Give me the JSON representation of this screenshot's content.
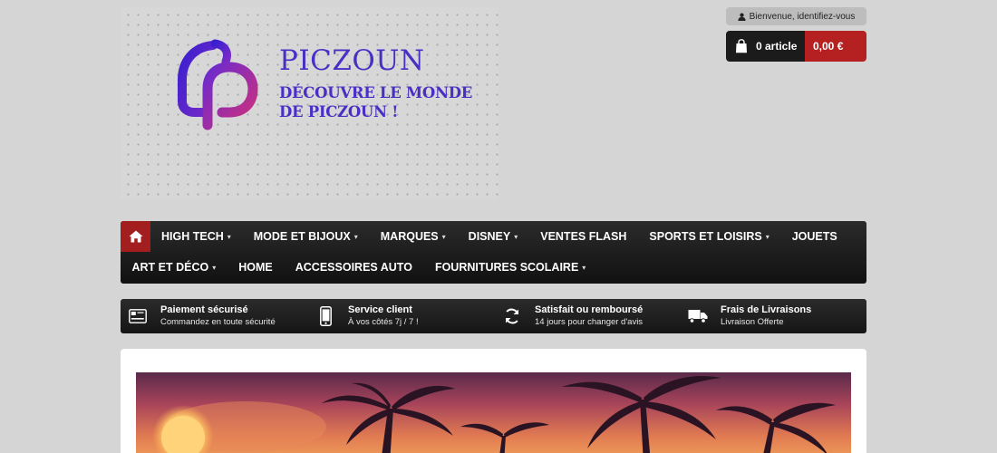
{
  "brand": {
    "name": "PICZOUN",
    "tagline_line1": "DÉCOUVRE LE MONDE",
    "tagline_line2": "DE PICZOUN !",
    "colors": {
      "purple": "#4a2fc4",
      "magenta": "#c2307a"
    }
  },
  "account": {
    "label": "Bienvenue, identifiez-vous",
    "icon": "user-icon"
  },
  "cart": {
    "count_label": "0 article",
    "total": "0,00 €",
    "icon": "shopping-bag-icon",
    "accent": "#b52121"
  },
  "nav": {
    "home_icon": "home-icon",
    "row1": [
      {
        "label": "HIGH TECH",
        "has_dropdown": true
      },
      {
        "label": "MODE ET BIJOUX",
        "has_dropdown": true
      },
      {
        "label": "MARQUES",
        "has_dropdown": true
      },
      {
        "label": "DISNEY",
        "has_dropdown": true
      },
      {
        "label": "VENTES FLASH",
        "has_dropdown": false
      },
      {
        "label": "SPORTS ET LOISIRS",
        "has_dropdown": true
      },
      {
        "label": "JOUETS",
        "has_dropdown": false
      }
    ],
    "row2": [
      {
        "label": "ART ET DÉCO",
        "has_dropdown": true
      },
      {
        "label": "HOME",
        "has_dropdown": false
      },
      {
        "label": "ACCESSOIRES AUTO",
        "has_dropdown": false
      },
      {
        "label": "FOURNITURES SCOLAIRE",
        "has_dropdown": true
      }
    ],
    "caret": "▾"
  },
  "reassurance": [
    {
      "title": "Paiement sécurisé",
      "subtitle": "Commandez en toute sécurité",
      "icon": "credit-card-icon"
    },
    {
      "title": "Service client",
      "subtitle": "À vos côtés 7j / 7 !",
      "icon": "phone-icon"
    },
    {
      "title": "Satisfait ou remboursé",
      "subtitle": "14 jours pour changer d'avis",
      "icon": "refresh-icon"
    },
    {
      "title": "Frais de Livraisons",
      "subtitle": "Livraison Offerte",
      "icon": "truck-icon"
    }
  ],
  "slider": {
    "image": "sunset-palm-trees-image"
  }
}
